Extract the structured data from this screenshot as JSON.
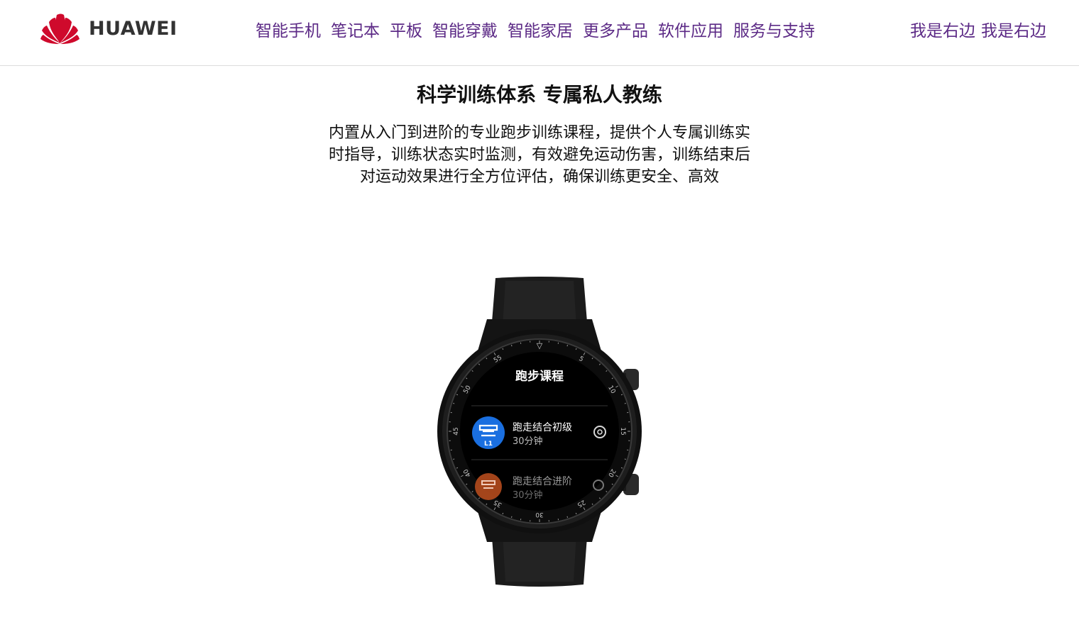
{
  "brand": {
    "name": "HUAWEI",
    "logo_color": "#cf0a2c"
  },
  "nav": {
    "items": [
      "智能手机",
      "笔记本",
      "平板",
      "智能穿戴",
      "智能家居",
      "更多产品",
      "软件应用",
      "服务与支持"
    ],
    "right": [
      "我是右边",
      "我是右边"
    ],
    "link_color": "#5c2a86"
  },
  "section": {
    "title": "科学训练体系 专属私人教练",
    "description": "内置从入门到进阶的专业跑步训练课程，提供个人专属训练实时指导，训练状态实时监测，有效避免运动伤害，训练结束后对运动效果进行全方位评估，确保训练更安全、高效"
  },
  "watch": {
    "screen_title": "跑步课程",
    "courses": [
      {
        "name": "跑走结合初级",
        "duration": "30分钟",
        "badge": "L1",
        "icon_color": "#1a6fe0"
      },
      {
        "name": "跑走结合进阶",
        "duration": "30分钟",
        "badge": "",
        "icon_color": "#c0501e"
      }
    ],
    "bezel_labels": [
      "55",
      "5",
      "10",
      "15",
      "20",
      "25",
      "30",
      "35",
      "40",
      "45",
      "50"
    ]
  }
}
